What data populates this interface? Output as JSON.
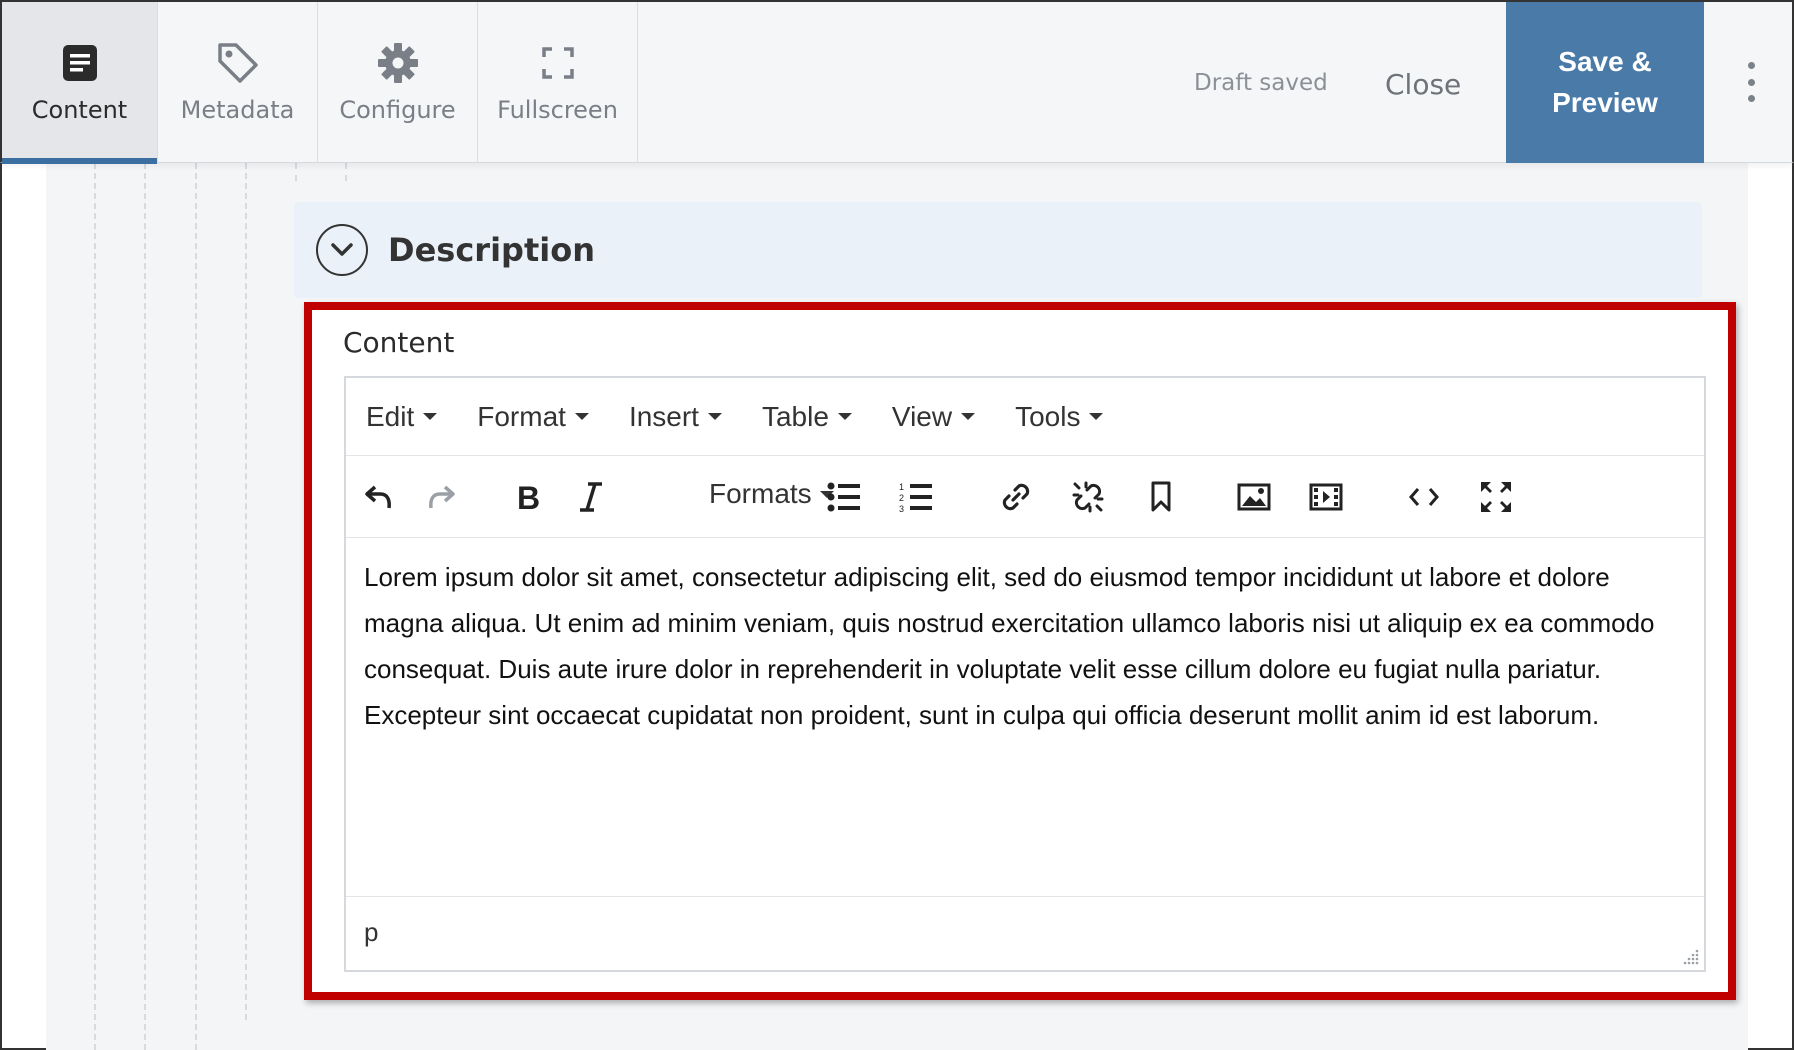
{
  "header": {
    "tabs": [
      {
        "label": "Content",
        "icon": "document-icon",
        "active": true
      },
      {
        "label": "Metadata",
        "icon": "tag-icon",
        "active": false
      },
      {
        "label": "Configure",
        "icon": "gear-icon",
        "active": false
      },
      {
        "label": "Fullscreen",
        "icon": "fullscreen-icon",
        "active": false
      }
    ],
    "draft_status": "Draft saved",
    "close_label": "Close",
    "save_line1": "Save &",
    "save_line2": "Preview",
    "accent_color": "#4a7aa8"
  },
  "section": {
    "title": "Description"
  },
  "field": {
    "label": "Content"
  },
  "editor": {
    "menu": [
      "Edit",
      "Format",
      "Insert",
      "Table",
      "View",
      "Tools"
    ],
    "formats_label": "Formats",
    "toolbar_icons": [
      "undo-icon",
      "redo-icon",
      "bold-icon",
      "italic-icon",
      "bullet-list-icon",
      "numbered-list-icon",
      "link-icon",
      "unlink-icon",
      "bookmark-icon",
      "image-icon",
      "media-icon",
      "source-code-icon",
      "fullscreen-icon"
    ],
    "body": "Lorem ipsum dolor sit amet, consectetur adipiscing elit, sed do eiusmod tempor incididunt ut labore et dolore magna aliqua. Ut enim ad minim veniam, quis nostrud exercitation ullamco laboris nisi ut aliquip ex ea commodo consequat. Duis aute irure dolor in reprehenderit in voluptate velit esse cillum dolore eu fugiat nulla pariatur. Excepteur sint occaecat cupidatat non proident, sunt in culpa qui officia deserunt mollit anim id est laborum.",
    "path": "p"
  },
  "highlight_color": "#c00000"
}
